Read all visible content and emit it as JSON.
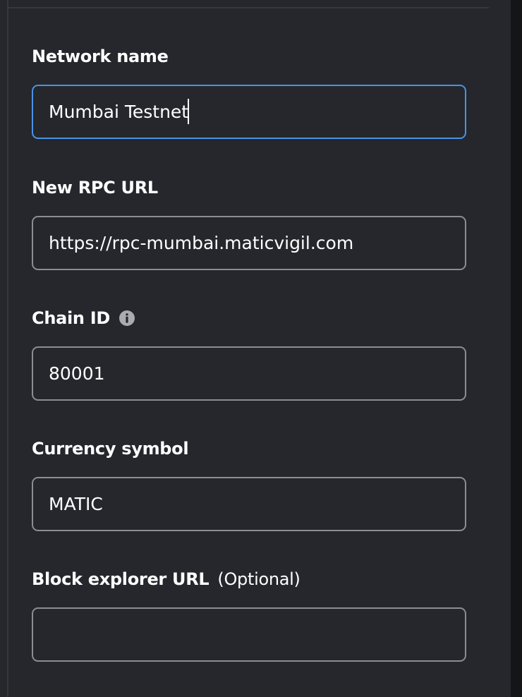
{
  "form": {
    "network_name": {
      "label": "Network name",
      "value": "Mumbai Testnet"
    },
    "rpc_url": {
      "label": "New RPC URL",
      "value": "https://rpc-mumbai.maticvigil.com"
    },
    "chain_id": {
      "label": "Chain ID",
      "value": "80001",
      "info_icon": "info-icon"
    },
    "currency_symbol": {
      "label": "Currency symbol",
      "value": "MATIC"
    },
    "block_explorer": {
      "label": "Block explorer URL",
      "optional_label": "(Optional)",
      "value": ""
    }
  },
  "colors": {
    "background": "#25272c",
    "focus_border": "#4b92e6",
    "input_border": "#8b8d93",
    "info_icon": "#a9abb0"
  }
}
